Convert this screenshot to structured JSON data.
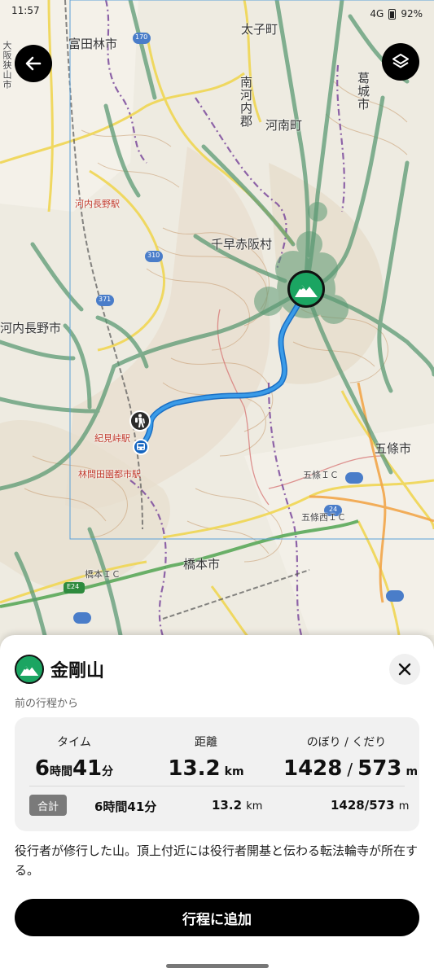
{
  "status_bar": {
    "time": "11:57",
    "network": "4G",
    "battery": "92%"
  },
  "map": {
    "labels": [
      {
        "id": "tondabayashi",
        "text": "富田林市"
      },
      {
        "id": "taishi",
        "text": "太子町"
      },
      {
        "id": "minamikawachi",
        "text": "南河内郡"
      },
      {
        "id": "kanan",
        "text": "河南町"
      },
      {
        "id": "katsuragi",
        "text": "葛城市"
      },
      {
        "id": "chihayaakasaka",
        "text": "千早赤阪村"
      },
      {
        "id": "kawachinagano",
        "text": "河内長野市"
      },
      {
        "id": "gojo",
        "text": "五條市"
      },
      {
        "id": "hashimoto",
        "text": "橋本市"
      },
      {
        "id": "osakasayama",
        "text": "大阪狭山市"
      },
      {
        "id": "kawachinagano-stn",
        "text": "河内長野駅"
      },
      {
        "id": "kimitoge-stn",
        "text": "紀見峠駅"
      },
      {
        "id": "rinkan-stn",
        "text": "林間田園都市駅"
      },
      {
        "id": "hashimoto-ic",
        "text": "橋本ＩＣ"
      },
      {
        "id": "gojo-ic",
        "text": "五條ＩＣ"
      },
      {
        "id": "gojo-nishi-ic",
        "text": "五條西ＩＣ"
      },
      {
        "id": "road-310",
        "text": "310"
      },
      {
        "id": "road-371",
        "text": "371"
      },
      {
        "id": "road-24",
        "text": "24"
      },
      {
        "id": "road-e24",
        "text": "E24"
      },
      {
        "id": "road-170",
        "text": "170"
      }
    ]
  },
  "sheet": {
    "title": "金剛山",
    "subtitle": "前の行程から",
    "stats": {
      "time": {
        "label": "タイム",
        "hours": "6",
        "hours_unit": "時間",
        "minutes": "41",
        "minutes_unit": "分"
      },
      "distance": {
        "label": "距離",
        "value": "13.2",
        "unit": "km"
      },
      "elevation": {
        "label": "のぼり / くだり",
        "up": "1428",
        "sep": "/",
        "down": "573",
        "unit": "m"
      }
    },
    "total": {
      "badge": "合計",
      "time": "6時間41分",
      "distance_value": "13.2",
      "distance_unit": "km",
      "elevation_value": "1428/573",
      "elevation_unit": "m"
    },
    "description": "役行者が修行した山。頂上付近には役行者開基と伝わる転法輪寺が所在する。",
    "add_button": "行程に追加"
  },
  "colors": {
    "accent_green": "#1ba562",
    "route_blue": "#2f8fe0",
    "trail_green": "#5c9a74"
  },
  "icons": {
    "back": "arrow-left-icon",
    "layers": "layers-icon",
    "peak": "mountain-icon",
    "hiker": "hiker-icon",
    "bus": "bus-icon",
    "close": "close-icon"
  }
}
